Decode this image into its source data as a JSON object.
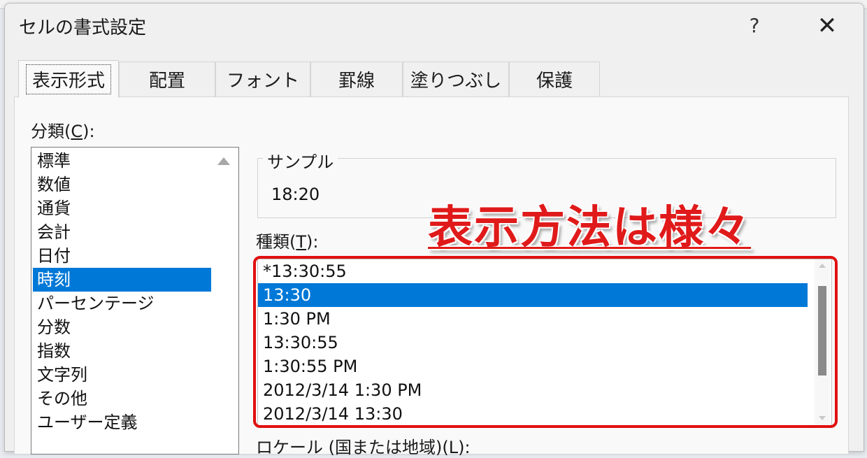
{
  "window": {
    "title": "セルの書式設定",
    "help_label": "?",
    "close_label": "✕"
  },
  "tabs": [
    {
      "label": "表示形式"
    },
    {
      "label": "配置"
    },
    {
      "label": "フォント"
    },
    {
      "label": "罫線"
    },
    {
      "label": "塗りつぶし"
    },
    {
      "label": "保護"
    }
  ],
  "category": {
    "label_prefix": "分類(",
    "label_key": "C",
    "label_suffix": "):",
    "items": [
      "標準",
      "数値",
      "通貨",
      "会計",
      "日付",
      "時刻",
      "パーセンテージ",
      "分数",
      "指数",
      "文字列",
      "その他",
      "ユーザー定義"
    ],
    "selected": "時刻"
  },
  "sample": {
    "title": "サンプル",
    "value": "18:20"
  },
  "types": {
    "label_prefix": "種類(",
    "label_key": "T",
    "label_suffix": "):",
    "items": [
      "*13:30:55",
      "13:30",
      "1:30 PM",
      "13:30:55",
      "1:30:55 PM",
      "2012/3/14 1:30 PM",
      "2012/3/14 13:30"
    ],
    "selected": "13:30"
  },
  "annotation": {
    "text": "表示方法は様々",
    "color": "#e01a1a"
  },
  "locale": {
    "label": "ロケール (国または地域)(L):"
  },
  "colors": {
    "selection": "#0078d7",
    "highlight_box": "#e01010"
  }
}
